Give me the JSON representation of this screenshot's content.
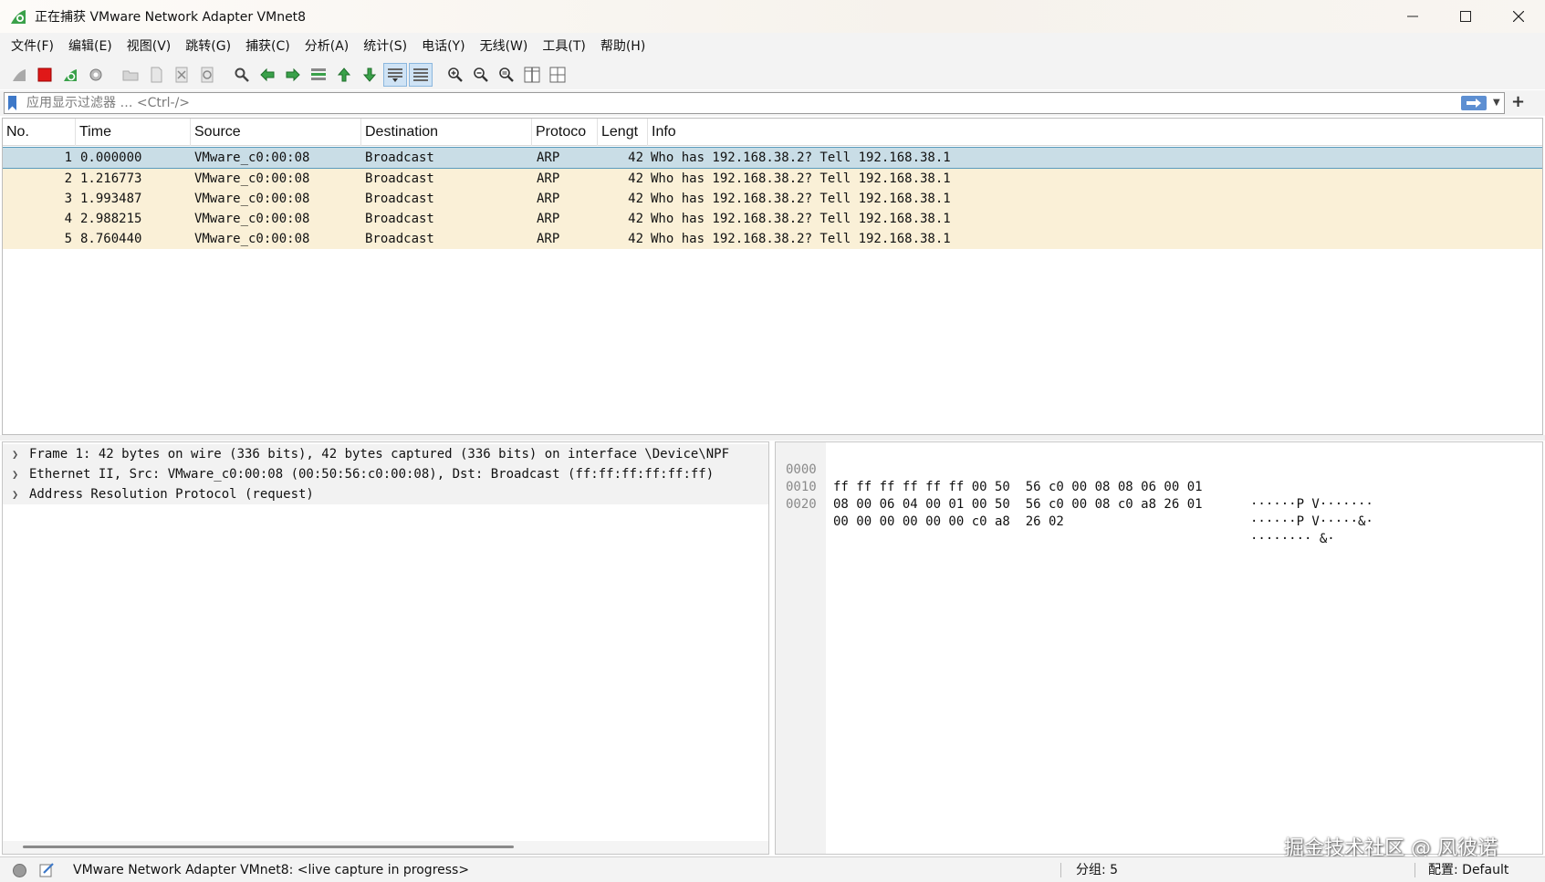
{
  "window": {
    "title": "正在捕获 VMware Network Adapter VMnet8"
  },
  "menu": [
    "文件(F)",
    "编辑(E)",
    "视图(V)",
    "跳转(G)",
    "捕获(C)",
    "分析(A)",
    "统计(S)",
    "电话(Y)",
    "无线(W)",
    "工具(T)",
    "帮助(H)"
  ],
  "toolbar": {
    "buttons": [
      "start-capture",
      "stop-capture",
      "restart-capture",
      "capture-options",
      "open-file",
      "save-file",
      "close-file",
      "reload-file",
      "find-packet",
      "go-back",
      "go-forward",
      "go-to-packet",
      "go-first",
      "go-last",
      "auto-scroll",
      "colorize",
      "zoom-in",
      "zoom-out",
      "zoom-normal",
      "resize-columns",
      "layout"
    ]
  },
  "filter": {
    "placeholder": "应用显示过滤器 … <Ctrl-/>"
  },
  "packet_list": {
    "columns": [
      "No.",
      "Time",
      "Source",
      "Destination",
      "Protoco",
      "Lengt",
      "Info"
    ],
    "rows": [
      {
        "no": "1",
        "time": "0.000000",
        "source": "VMware_c0:00:08",
        "destination": "Broadcast",
        "protocol": "ARP",
        "length": "42",
        "info": "Who has 192.168.38.2? Tell 192.168.38.1"
      },
      {
        "no": "2",
        "time": "1.216773",
        "source": "VMware_c0:00:08",
        "destination": "Broadcast",
        "protocol": "ARP",
        "length": "42",
        "info": "Who has 192.168.38.2? Tell 192.168.38.1"
      },
      {
        "no": "3",
        "time": "1.993487",
        "source": "VMware_c0:00:08",
        "destination": "Broadcast",
        "protocol": "ARP",
        "length": "42",
        "info": "Who has 192.168.38.2? Tell 192.168.38.1"
      },
      {
        "no": "4",
        "time": "2.988215",
        "source": "VMware_c0:00:08",
        "destination": "Broadcast",
        "protocol": "ARP",
        "length": "42",
        "info": "Who has 192.168.38.2? Tell 192.168.38.1"
      },
      {
        "no": "5",
        "time": "8.760440",
        "source": "VMware_c0:00:08",
        "destination": "Broadcast",
        "protocol": "ARP",
        "length": "42",
        "info": "Who has 192.168.38.2? Tell 192.168.38.1"
      }
    ]
  },
  "details": [
    "Frame 1: 42 bytes on wire (336 bits), 42 bytes captured (336 bits) on interface \\Device\\NPF",
    "Ethernet II, Src: VMware_c0:00:08 (00:50:56:c0:00:08), Dst: Broadcast (ff:ff:ff:ff:ff:ff)",
    "Address Resolution Protocol (request)"
  ],
  "bytes": [
    {
      "offset": "0000",
      "hex": "ff ff ff ff ff ff 00 50  56 c0 00 08 08 06 00 01",
      "ascii": "······P V·······"
    },
    {
      "offset": "0010",
      "hex": "08 00 06 04 00 01 00 50  56 c0 00 08 c0 a8 26 01",
      "ascii": "······P V·····&·"
    },
    {
      "offset": "0020",
      "hex": "00 00 00 00 00 00 c0 a8  26 02",
      "ascii": "········ &·"
    }
  ],
  "status": {
    "capture_text": "VMware Network Adapter VMnet8: <live capture in progress>",
    "packets": "分组: 5",
    "profile": "配置: Default"
  },
  "watermark": "掘金技术社区 @ 风彼诺",
  "colors": {
    "row_bg": "#faf0d7",
    "selected_row": "#c9dde6",
    "accent": "#3d78c8"
  }
}
